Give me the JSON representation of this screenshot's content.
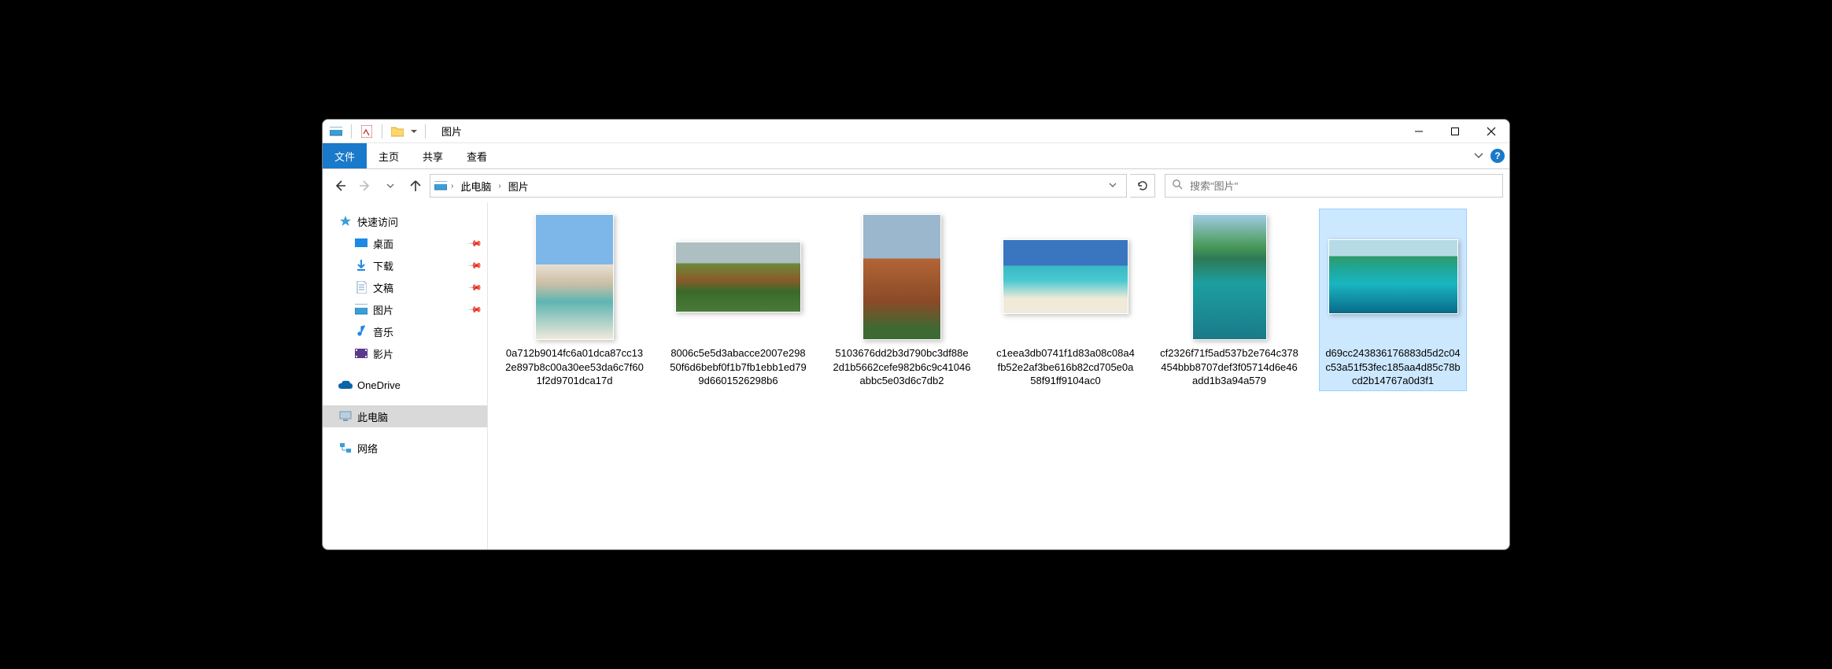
{
  "window": {
    "title": "图片"
  },
  "ribbon": {
    "file": "文件",
    "tabs": [
      "主页",
      "共享",
      "查看"
    ]
  },
  "address": {
    "segments": [
      "此电脑",
      "图片"
    ]
  },
  "search": {
    "placeholder": "搜索\"图片\""
  },
  "sidebar": {
    "quick_access": "快速访问",
    "items": [
      {
        "label": "桌面",
        "pinned": true
      },
      {
        "label": "下载",
        "pinned": true
      },
      {
        "label": "文稿",
        "pinned": true
      },
      {
        "label": "图片",
        "pinned": true
      },
      {
        "label": "音乐",
        "pinned": false
      },
      {
        "label": "影片",
        "pinned": false
      }
    ],
    "onedrive": "OneDrive",
    "this_pc": "此电脑",
    "network": "网络"
  },
  "files": [
    {
      "name": "0a712b9014fc6a01dca87cc132e897b8c00a30ee53da6c7f601f2d9701dca17d",
      "selected": false
    },
    {
      "name": "8006c5e5d3abacce2007e29850f6d6bebf0f1b7fb1ebb1ed799d6601526298b6",
      "selected": false
    },
    {
      "name": "5103676dd2b3d790bc3df88e2d1b5662cefe982b6c9c41046abbc5e03d6c7db2",
      "selected": false
    },
    {
      "name": "c1eea3db0741f1d83a08c08a4fb52e2af3be616b82cd705e0a58f91ff9104ac0",
      "selected": false
    },
    {
      "name": "cf2326f71f5ad537b2e764c378454bbb8707def3f05714d6e46add1b3a94a579",
      "selected": false
    },
    {
      "name": "d69cc243836176883d5d2c04c53a51f53fec185aa4d85c78bcd2b14767a0d3f1",
      "selected": true
    }
  ]
}
